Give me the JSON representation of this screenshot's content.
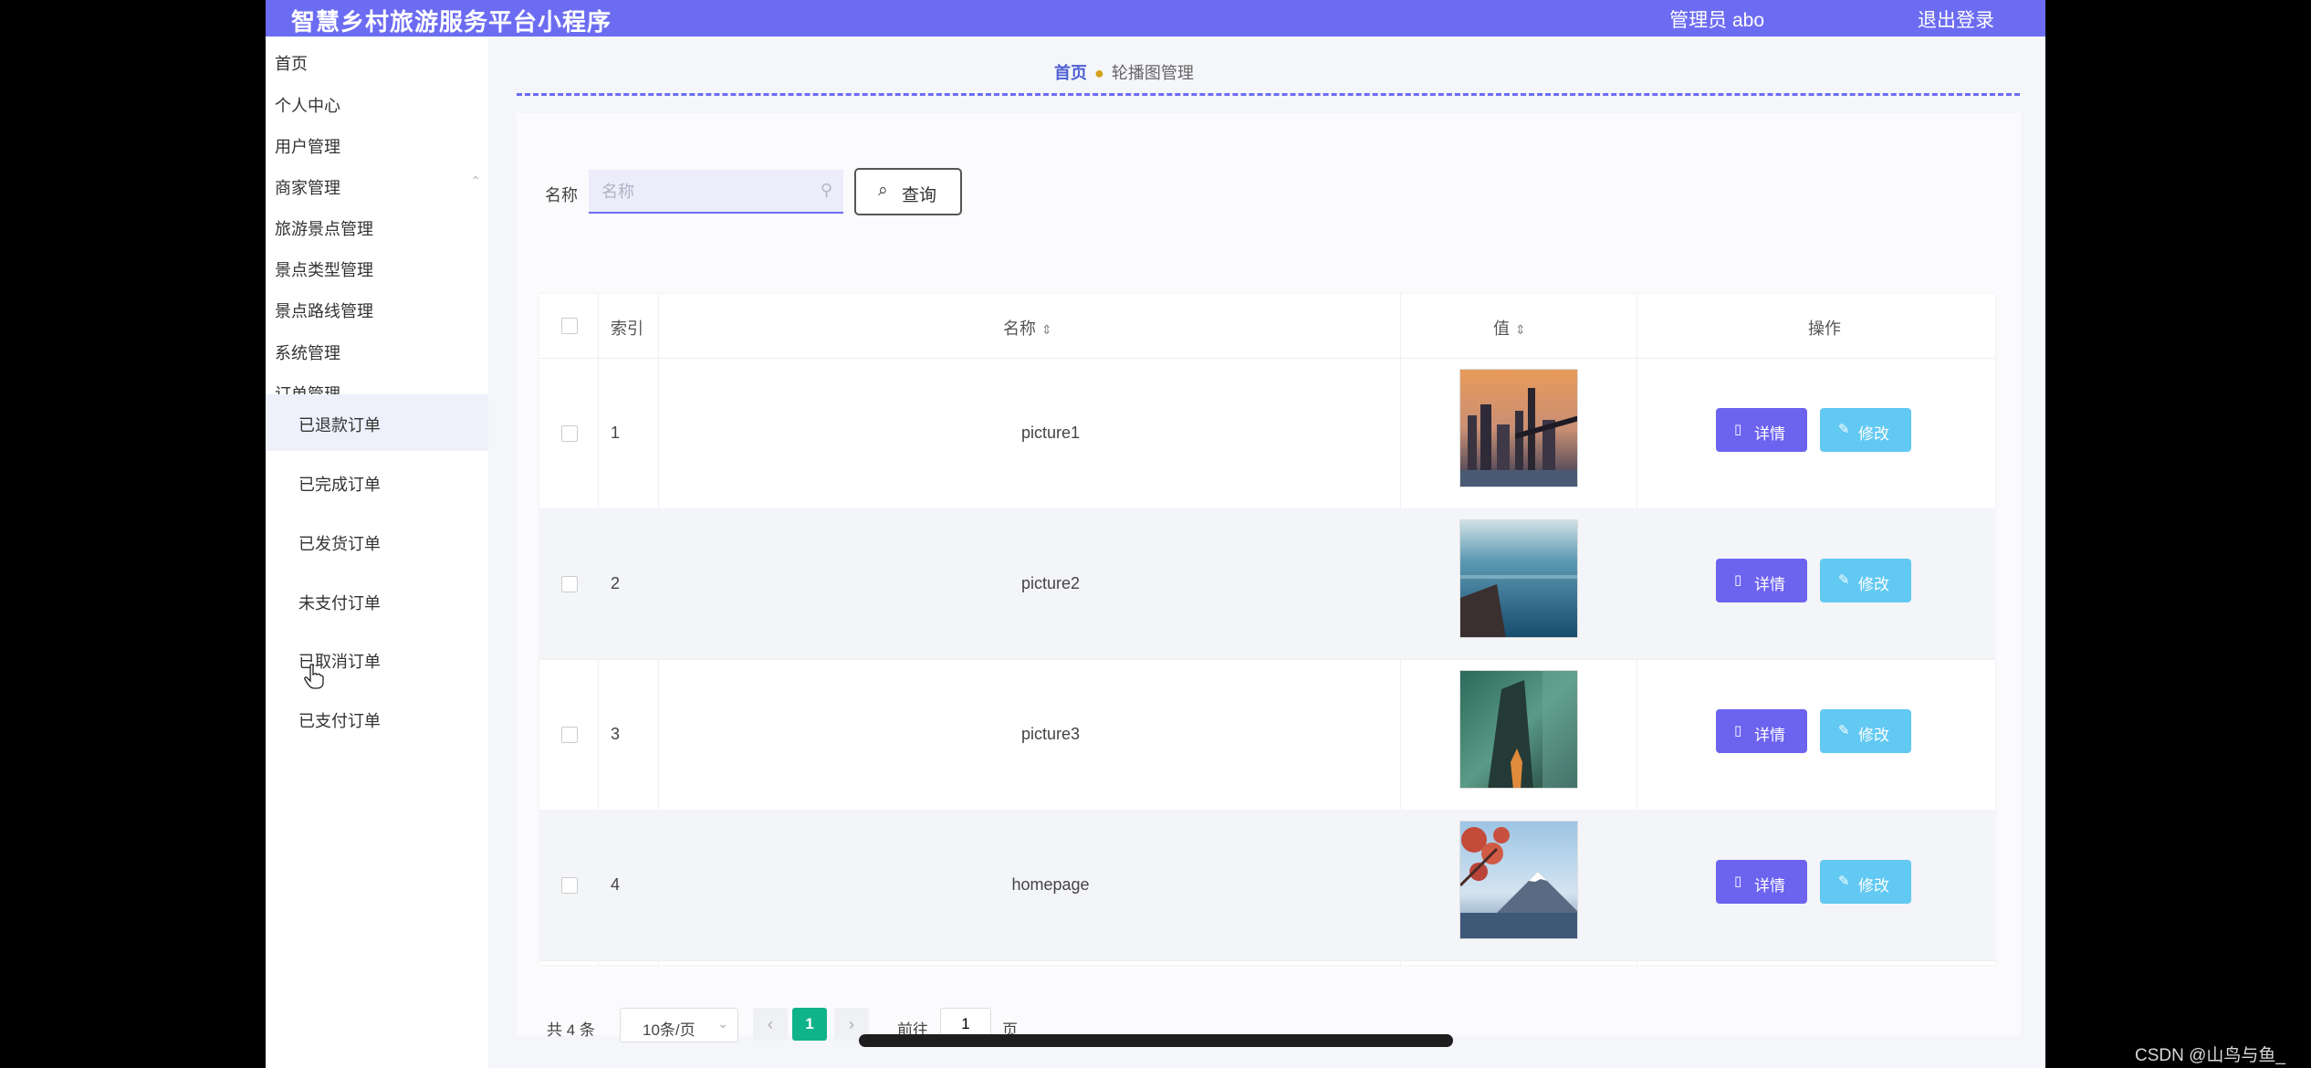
{
  "app": {
    "title": "智慧乡村旅游服务平台小程序",
    "user": "管理员 abo",
    "logout": "退出登录"
  },
  "sidebar": {
    "items": [
      {
        "label": "首页"
      },
      {
        "label": "个人中心"
      },
      {
        "label": "用户管理"
      },
      {
        "label": "商家管理"
      },
      {
        "label": "旅游景点管理"
      },
      {
        "label": "景点类型管理"
      },
      {
        "label": "景点路线管理"
      },
      {
        "label": "系统管理"
      },
      {
        "label": "订单管理"
      }
    ],
    "order_sub": [
      {
        "label": "已退款订单"
      },
      {
        "label": "已完成订单"
      },
      {
        "label": "已发货订单"
      },
      {
        "label": "未支付订单"
      },
      {
        "label": "已取消订单"
      },
      {
        "label": "已支付订单"
      }
    ]
  },
  "breadcrumb": {
    "home": "首页",
    "current": "轮播图管理"
  },
  "search": {
    "label": "名称",
    "placeholder": "名称",
    "button": "查询"
  },
  "table": {
    "headers": {
      "index": "索引",
      "name": "名称",
      "value": "值",
      "actions": "操作"
    },
    "rows": [
      {
        "index": "1",
        "name": "picture1"
      },
      {
        "index": "2",
        "name": "picture2"
      },
      {
        "index": "3",
        "name": "picture3"
      },
      {
        "index": "4",
        "name": "homepage"
      }
    ],
    "detail_label": "详情",
    "edit_label": "修改"
  },
  "pagination": {
    "total": "共 4 条",
    "page_size": "10条/页",
    "current_page": "1",
    "goto_label": "前往",
    "goto_value": "1",
    "page_unit": "页"
  },
  "colors": {
    "topbar": "#6c6cf2",
    "detail_button": "#6c63ef",
    "edit_button": "#62c9f2",
    "active_page": "#10b28a"
  },
  "watermark": "CSDN @山鸟与鱼_"
}
